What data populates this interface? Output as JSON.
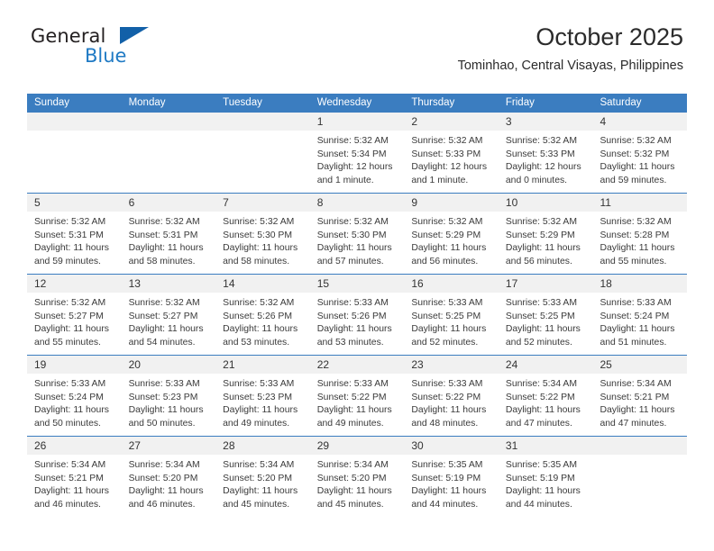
{
  "brand": {
    "name_dark": "General",
    "name_blue": "Blue",
    "accent_color": "#1260a8",
    "blue_text_color": "#1f7ac4"
  },
  "header": {
    "title": "October 2025",
    "subtitle": "Tominhao, Central Visayas, Philippines"
  },
  "theme": {
    "header_bar_color": "#3b7dc0",
    "day_band_color": "#f1f1f1",
    "row_divider_color": "#3b7dc0",
    "text_color": "#3a3a3a"
  },
  "weekdays": [
    "Sunday",
    "Monday",
    "Tuesday",
    "Wednesday",
    "Thursday",
    "Friday",
    "Saturday"
  ],
  "labels": {
    "sunrise_prefix": "Sunrise:",
    "sunset_prefix": "Sunset:",
    "daylight_prefix": "Daylight:"
  },
  "weeks": [
    [
      {
        "day": "",
        "sunrise": "",
        "sunset": "",
        "daylight_1": "",
        "daylight_2": ""
      },
      {
        "day": "",
        "sunrise": "",
        "sunset": "",
        "daylight_1": "",
        "daylight_2": ""
      },
      {
        "day": "",
        "sunrise": "",
        "sunset": "",
        "daylight_1": "",
        "daylight_2": ""
      },
      {
        "day": "1",
        "sunrise": "Sunrise: 5:32 AM",
        "sunset": "Sunset: 5:34 PM",
        "daylight_1": "Daylight: 12 hours",
        "daylight_2": "and 1 minute."
      },
      {
        "day": "2",
        "sunrise": "Sunrise: 5:32 AM",
        "sunset": "Sunset: 5:33 PM",
        "daylight_1": "Daylight: 12 hours",
        "daylight_2": "and 1 minute."
      },
      {
        "day": "3",
        "sunrise": "Sunrise: 5:32 AM",
        "sunset": "Sunset: 5:33 PM",
        "daylight_1": "Daylight: 12 hours",
        "daylight_2": "and 0 minutes."
      },
      {
        "day": "4",
        "sunrise": "Sunrise: 5:32 AM",
        "sunset": "Sunset: 5:32 PM",
        "daylight_1": "Daylight: 11 hours",
        "daylight_2": "and 59 minutes."
      }
    ],
    [
      {
        "day": "5",
        "sunrise": "Sunrise: 5:32 AM",
        "sunset": "Sunset: 5:31 PM",
        "daylight_1": "Daylight: 11 hours",
        "daylight_2": "and 59 minutes."
      },
      {
        "day": "6",
        "sunrise": "Sunrise: 5:32 AM",
        "sunset": "Sunset: 5:31 PM",
        "daylight_1": "Daylight: 11 hours",
        "daylight_2": "and 58 minutes."
      },
      {
        "day": "7",
        "sunrise": "Sunrise: 5:32 AM",
        "sunset": "Sunset: 5:30 PM",
        "daylight_1": "Daylight: 11 hours",
        "daylight_2": "and 58 minutes."
      },
      {
        "day": "8",
        "sunrise": "Sunrise: 5:32 AM",
        "sunset": "Sunset: 5:30 PM",
        "daylight_1": "Daylight: 11 hours",
        "daylight_2": "and 57 minutes."
      },
      {
        "day": "9",
        "sunrise": "Sunrise: 5:32 AM",
        "sunset": "Sunset: 5:29 PM",
        "daylight_1": "Daylight: 11 hours",
        "daylight_2": "and 56 minutes."
      },
      {
        "day": "10",
        "sunrise": "Sunrise: 5:32 AM",
        "sunset": "Sunset: 5:29 PM",
        "daylight_1": "Daylight: 11 hours",
        "daylight_2": "and 56 minutes."
      },
      {
        "day": "11",
        "sunrise": "Sunrise: 5:32 AM",
        "sunset": "Sunset: 5:28 PM",
        "daylight_1": "Daylight: 11 hours",
        "daylight_2": "and 55 minutes."
      }
    ],
    [
      {
        "day": "12",
        "sunrise": "Sunrise: 5:32 AM",
        "sunset": "Sunset: 5:27 PM",
        "daylight_1": "Daylight: 11 hours",
        "daylight_2": "and 55 minutes."
      },
      {
        "day": "13",
        "sunrise": "Sunrise: 5:32 AM",
        "sunset": "Sunset: 5:27 PM",
        "daylight_1": "Daylight: 11 hours",
        "daylight_2": "and 54 minutes."
      },
      {
        "day": "14",
        "sunrise": "Sunrise: 5:32 AM",
        "sunset": "Sunset: 5:26 PM",
        "daylight_1": "Daylight: 11 hours",
        "daylight_2": "and 53 minutes."
      },
      {
        "day": "15",
        "sunrise": "Sunrise: 5:33 AM",
        "sunset": "Sunset: 5:26 PM",
        "daylight_1": "Daylight: 11 hours",
        "daylight_2": "and 53 minutes."
      },
      {
        "day": "16",
        "sunrise": "Sunrise: 5:33 AM",
        "sunset": "Sunset: 5:25 PM",
        "daylight_1": "Daylight: 11 hours",
        "daylight_2": "and 52 minutes."
      },
      {
        "day": "17",
        "sunrise": "Sunrise: 5:33 AM",
        "sunset": "Sunset: 5:25 PM",
        "daylight_1": "Daylight: 11 hours",
        "daylight_2": "and 52 minutes."
      },
      {
        "day": "18",
        "sunrise": "Sunrise: 5:33 AM",
        "sunset": "Sunset: 5:24 PM",
        "daylight_1": "Daylight: 11 hours",
        "daylight_2": "and 51 minutes."
      }
    ],
    [
      {
        "day": "19",
        "sunrise": "Sunrise: 5:33 AM",
        "sunset": "Sunset: 5:24 PM",
        "daylight_1": "Daylight: 11 hours",
        "daylight_2": "and 50 minutes."
      },
      {
        "day": "20",
        "sunrise": "Sunrise: 5:33 AM",
        "sunset": "Sunset: 5:23 PM",
        "daylight_1": "Daylight: 11 hours",
        "daylight_2": "and 50 minutes."
      },
      {
        "day": "21",
        "sunrise": "Sunrise: 5:33 AM",
        "sunset": "Sunset: 5:23 PM",
        "daylight_1": "Daylight: 11 hours",
        "daylight_2": "and 49 minutes."
      },
      {
        "day": "22",
        "sunrise": "Sunrise: 5:33 AM",
        "sunset": "Sunset: 5:22 PM",
        "daylight_1": "Daylight: 11 hours",
        "daylight_2": "and 49 minutes."
      },
      {
        "day": "23",
        "sunrise": "Sunrise: 5:33 AM",
        "sunset": "Sunset: 5:22 PM",
        "daylight_1": "Daylight: 11 hours",
        "daylight_2": "and 48 minutes."
      },
      {
        "day": "24",
        "sunrise": "Sunrise: 5:34 AM",
        "sunset": "Sunset: 5:22 PM",
        "daylight_1": "Daylight: 11 hours",
        "daylight_2": "and 47 minutes."
      },
      {
        "day": "25",
        "sunrise": "Sunrise: 5:34 AM",
        "sunset": "Sunset: 5:21 PM",
        "daylight_1": "Daylight: 11 hours",
        "daylight_2": "and 47 minutes."
      }
    ],
    [
      {
        "day": "26",
        "sunrise": "Sunrise: 5:34 AM",
        "sunset": "Sunset: 5:21 PM",
        "daylight_1": "Daylight: 11 hours",
        "daylight_2": "and 46 minutes."
      },
      {
        "day": "27",
        "sunrise": "Sunrise: 5:34 AM",
        "sunset": "Sunset: 5:20 PM",
        "daylight_1": "Daylight: 11 hours",
        "daylight_2": "and 46 minutes."
      },
      {
        "day": "28",
        "sunrise": "Sunrise: 5:34 AM",
        "sunset": "Sunset: 5:20 PM",
        "daylight_1": "Daylight: 11 hours",
        "daylight_2": "and 45 minutes."
      },
      {
        "day": "29",
        "sunrise": "Sunrise: 5:34 AM",
        "sunset": "Sunset: 5:20 PM",
        "daylight_1": "Daylight: 11 hours",
        "daylight_2": "and 45 minutes."
      },
      {
        "day": "30",
        "sunrise": "Sunrise: 5:35 AM",
        "sunset": "Sunset: 5:19 PM",
        "daylight_1": "Daylight: 11 hours",
        "daylight_2": "and 44 minutes."
      },
      {
        "day": "31",
        "sunrise": "Sunrise: 5:35 AM",
        "sunset": "Sunset: 5:19 PM",
        "daylight_1": "Daylight: 11 hours",
        "daylight_2": "and 44 minutes."
      },
      {
        "day": "",
        "sunrise": "",
        "sunset": "",
        "daylight_1": "",
        "daylight_2": ""
      }
    ]
  ]
}
